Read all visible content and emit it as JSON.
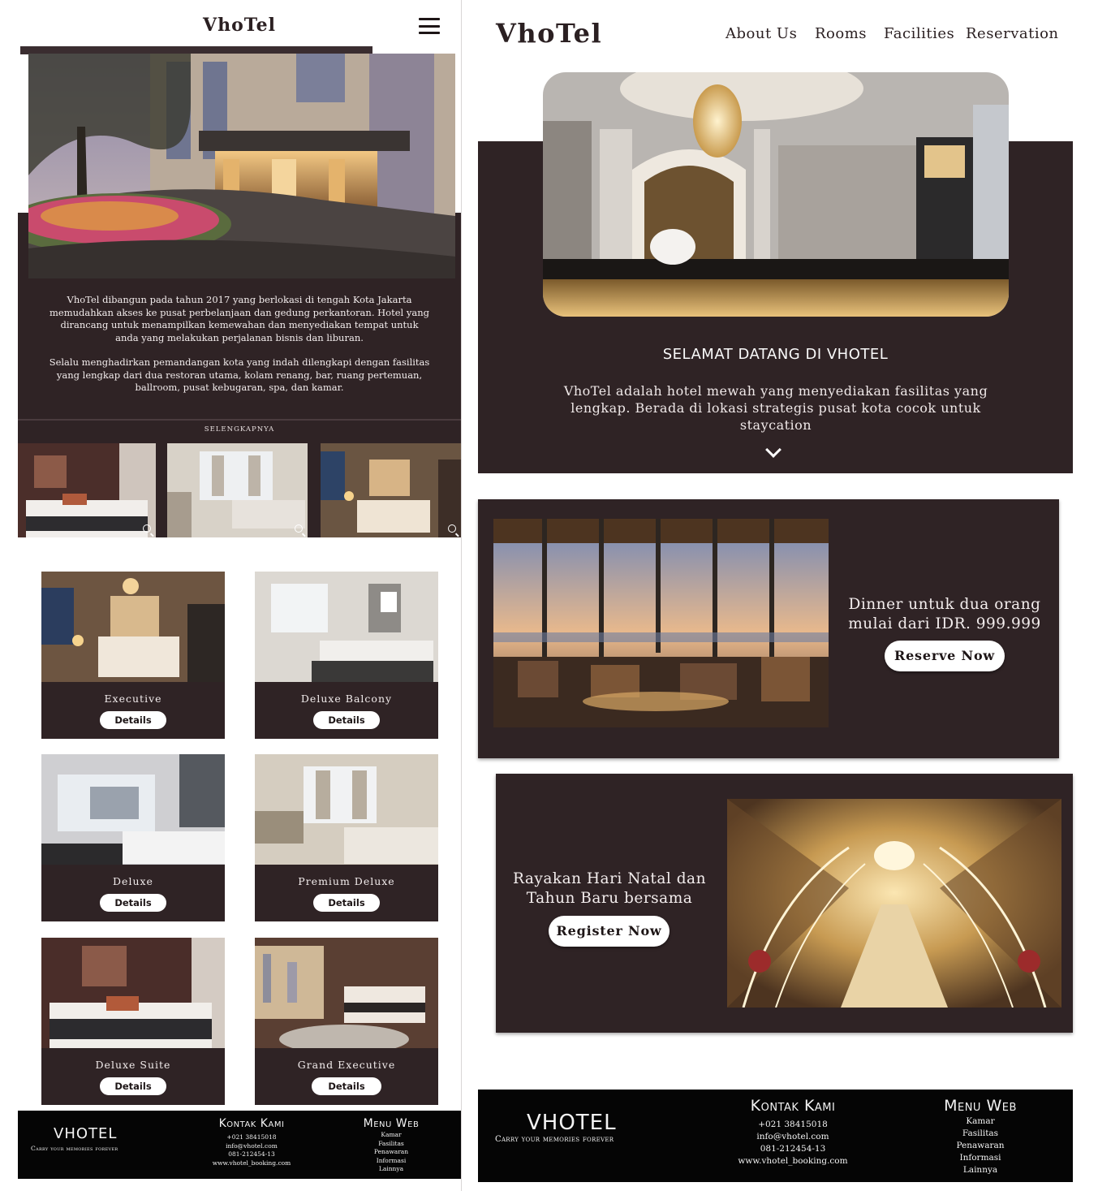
{
  "mobile": {
    "logo": "VhoTel",
    "about_p1": "VhoTel dibangun pada tahun 2017 yang berlokasi di tengah Kota Jakarta memudahkan akses ke pusat perbelanjaan dan gedung perkantoran. Hotel yang dirancang untuk menampilkan kemewahan dan menyediakan tempat untuk anda yang melakukan perjalanan bisnis dan liburan.",
    "about_p2": "Selalu menghadirkan pemandangan kota yang indah dilengkapi dengan fasilitas yang lengkap dari dua restoran utama, kolam renang, bar, ruang pertemuan, ballroom, pusat kebugaran, spa, dan kamar.",
    "more_link": "SELENGKAPNYA",
    "rooms": [
      {
        "name": "Executive",
        "button": "Details"
      },
      {
        "name": "Deluxe Balcony",
        "button": "Details"
      },
      {
        "name": "Deluxe",
        "button": "Details"
      },
      {
        "name": "Premium Deluxe",
        "button": "Details"
      },
      {
        "name": "Deluxe Suite",
        "button": "Details"
      },
      {
        "name": "Grand Executive",
        "button": "Details"
      }
    ]
  },
  "desktop": {
    "logo": "VhoTel",
    "nav": [
      "About Us",
      "Rooms",
      "Facilities",
      "Reservation"
    ],
    "welcome_title": "SELAMAT DATANG DI VHOTEL",
    "welcome_text": "VhoTel adalah hotel mewah yang menyediakan fasilitas yang lengkap. Berada di lokasi strategis pusat kota cocok untuk staycation",
    "promo_dinner": {
      "text": "Dinner untuk dua orang mulai dari IDR. 999.999",
      "button": "Reserve Now"
    },
    "promo_christmas": {
      "text": "Rayakan Hari Natal dan Tahun Baru bersama",
      "button": "Register Now"
    }
  },
  "footer": {
    "brand": "VHOTEL",
    "tagline": "Carry your memories forever",
    "contact_title": "Kontak Kami",
    "contact": [
      "+021 38415018",
      "info@vhotel.com",
      "081-212454-13",
      "www.vhotel_booking.com"
    ],
    "menu_title": "Menu Web",
    "menu": [
      "Kamar",
      "Fasilitas",
      "Penawaran",
      "Informasi",
      "Lainnya"
    ]
  },
  "colors": {
    "brand_dark": "#2f2325",
    "footer_black": "#050505",
    "white": "#ffffff"
  }
}
